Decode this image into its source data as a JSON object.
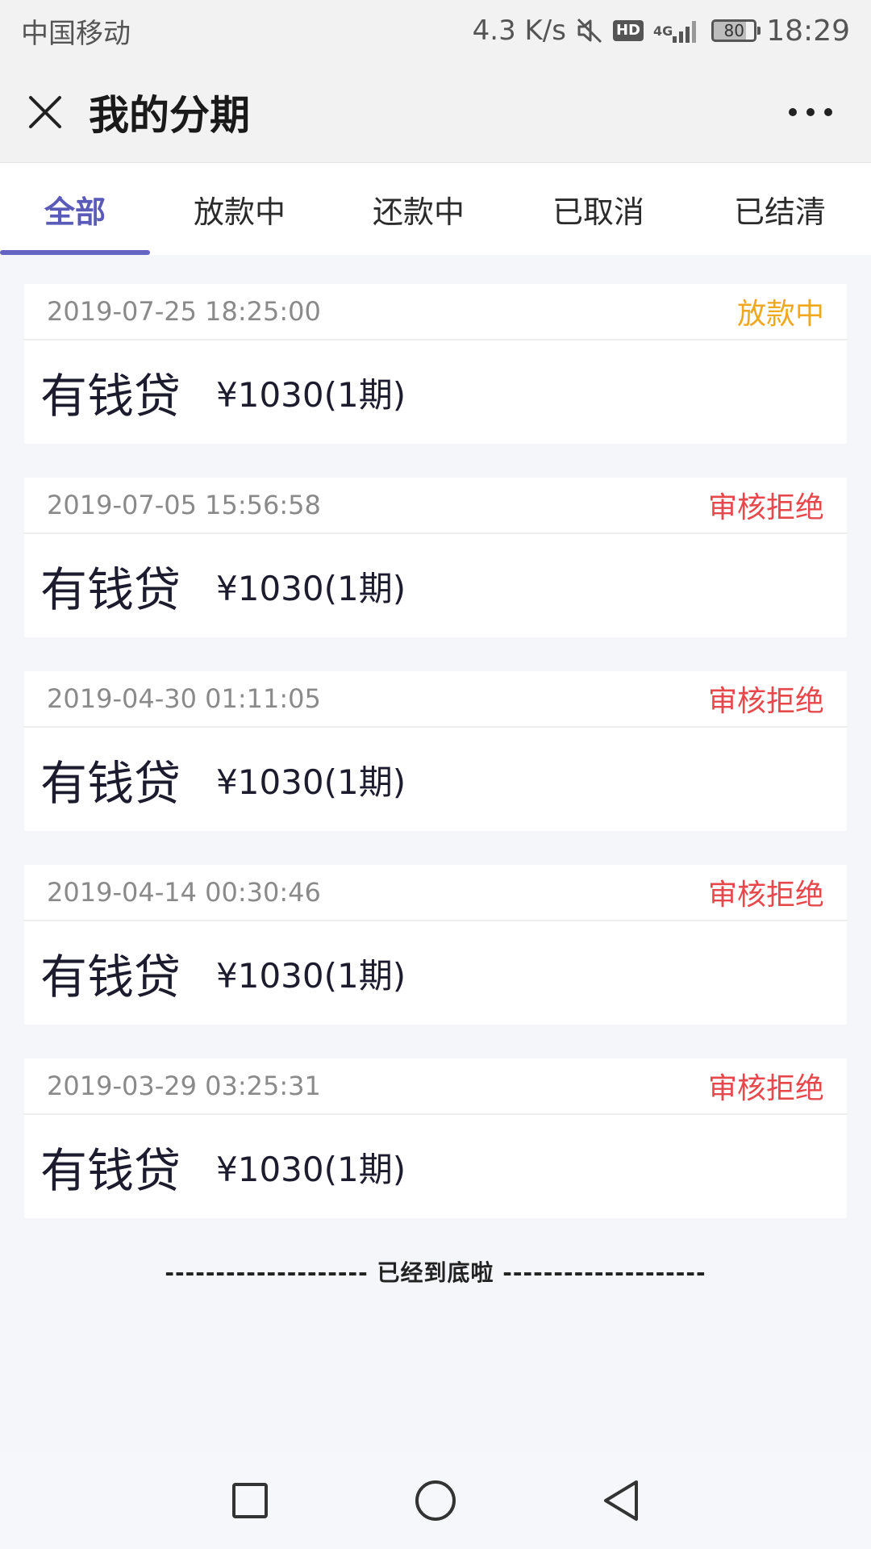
{
  "status_bar": {
    "carrier": "中国移动",
    "net_speed": "4.3 K/s",
    "hd": "HD",
    "signal_label": "4G",
    "battery": "80",
    "time": "18:29"
  },
  "header": {
    "title": "我的分期"
  },
  "tabs": [
    {
      "label": "全部",
      "active": true
    },
    {
      "label": "放款中",
      "active": false
    },
    {
      "label": "还款中",
      "active": false
    },
    {
      "label": "已取消",
      "active": false
    },
    {
      "label": "已结清",
      "active": false
    }
  ],
  "colors": {
    "accent": "#5a5bb8",
    "status_pending": "#f0a81e",
    "status_rejected": "#e8484b"
  },
  "records": [
    {
      "time": "2019-07-25 18:25:00",
      "status": "放款中",
      "status_color": "#f0a81e",
      "product": "有钱贷",
      "amount": "¥1030(1期)"
    },
    {
      "time": "2019-07-05 15:56:58",
      "status": "审核拒绝",
      "status_color": "#e8484b",
      "product": "有钱贷",
      "amount": "¥1030(1期)"
    },
    {
      "time": "2019-04-30 01:11:05",
      "status": "审核拒绝",
      "status_color": "#e8484b",
      "product": "有钱贷",
      "amount": "¥1030(1期)"
    },
    {
      "time": "2019-04-14 00:30:46",
      "status": "审核拒绝",
      "status_color": "#e8484b",
      "product": "有钱贷",
      "amount": "¥1030(1期)"
    },
    {
      "time": "2019-03-29 03:25:31",
      "status": "审核拒绝",
      "status_color": "#e8484b",
      "product": "有钱贷",
      "amount": "¥1030(1期)"
    }
  ],
  "footer": {
    "end_text": "-------------------- 已经到底啦 --------------------"
  },
  "icons": {
    "close": "close-icon",
    "more": "more-icon",
    "mute": "mute-icon",
    "signal": "signal-icon",
    "nav_recent": "square-icon",
    "nav_home": "circle-icon",
    "nav_back": "triangle-back-icon"
  }
}
